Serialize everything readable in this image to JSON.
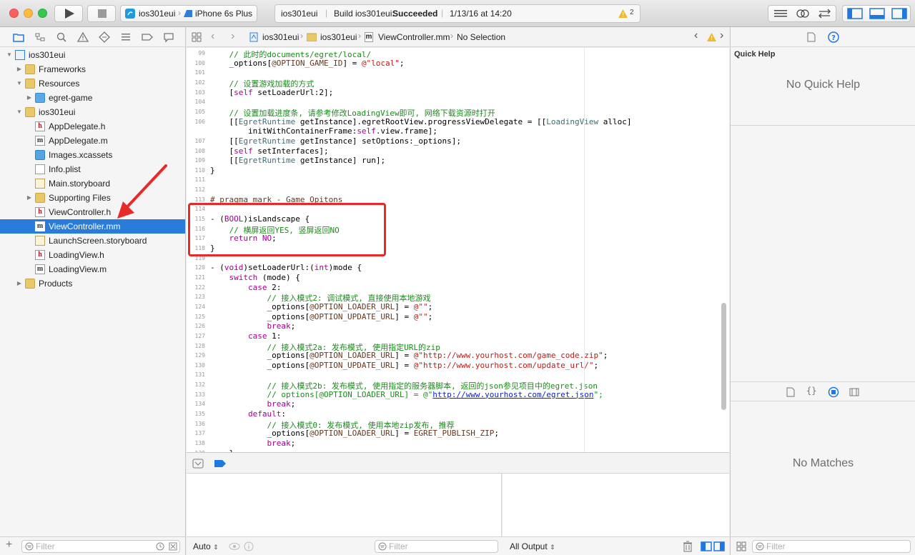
{
  "toolbar": {
    "scheme_target": "ios301eui",
    "scheme_device": "iPhone 6s Plus",
    "activity_project": "ios301eui",
    "activity_status_prefix": "Build ios301eui:",
    "activity_status_result": "Succeeded",
    "activity_date": "1/13/16 at 14:20",
    "warning_count": "2"
  },
  "navigator": {
    "tree": [
      {
        "label": "ios301eui",
        "icon": "project-icon",
        "level": 0,
        "open": true
      },
      {
        "label": "Frameworks",
        "icon": "folder-icon",
        "level": 1,
        "open": false
      },
      {
        "label": "Resources",
        "icon": "folder-icon",
        "level": 1,
        "open": true
      },
      {
        "label": "egret-game",
        "icon": "blue-folder-icon",
        "level": 2,
        "open": false
      },
      {
        "label": "ios301eui",
        "icon": "folder-icon",
        "level": 1,
        "open": true
      },
      {
        "label": "AppDelegate.h",
        "icon": "header-file-icon",
        "level": 2
      },
      {
        "label": "AppDelegate.m",
        "icon": "impl-file-icon",
        "level": 2
      },
      {
        "label": "Images.xcassets",
        "icon": "assets-icon",
        "level": 2
      },
      {
        "label": "Info.plist",
        "icon": "plist-file-icon",
        "level": 2
      },
      {
        "label": "Main.storyboard",
        "icon": "storyboard-icon",
        "level": 2
      },
      {
        "label": "Supporting Files",
        "icon": "folder-icon",
        "level": 2,
        "open": false
      },
      {
        "label": "ViewController.h",
        "icon": "header-file-icon",
        "level": 2
      },
      {
        "label": "ViewController.mm",
        "icon": "impl-file-icon",
        "level": 2,
        "selected": true
      },
      {
        "label": "LaunchScreen.storyboard",
        "icon": "storyboard-icon",
        "level": 2
      },
      {
        "label": "LoadingView.h",
        "icon": "header-file-icon",
        "level": 2
      },
      {
        "label": "LoadingView.m",
        "icon": "impl-file-icon",
        "level": 2
      },
      {
        "label": "Products",
        "icon": "folder-icon",
        "level": 1,
        "open": false
      }
    ],
    "filter_placeholder": "Filter"
  },
  "jumpbar": {
    "crumb_project": "ios301eui",
    "crumb_group": "ios301eui",
    "crumb_file": "ViewController.mm",
    "crumb_symbol": "No Selection"
  },
  "code": [
    {
      "n": "99",
      "html": "    <span class=\"cm\">// 此时的documents/egret/local/</span>"
    },
    {
      "n": "100",
      "html": "    _options[<span class=\"mac\">@OPTION_GAME_ID</span>] = <span class=\"st\">@\"local\"</span>;"
    },
    {
      "n": "101",
      "html": ""
    },
    {
      "n": "102",
      "html": "    <span class=\"cm\">// 设置游戏加载的方式</span>"
    },
    {
      "n": "103",
      "html": "    [<span class=\"kw\">self</span> setLoaderUrl:2];"
    },
    {
      "n": "104",
      "html": ""
    },
    {
      "n": "105",
      "html": "    <span class=\"cm\">// 设置加载进度条, 请参考修改LoadingView即可, 网络下载资源时打开</span>"
    },
    {
      "n": "106",
      "html": "    [[<span class=\"cls\">EgretRuntime</span> getInstance].egretRootView.progressViewDelegate = [[<span class=\"cls\">LoadingView</span> alloc]"
    },
    {
      "n": "",
      "html": "        initWithContainerFrame:<span class=\"kw\">self</span>.view.frame];"
    },
    {
      "n": "107",
      "html": "    [[<span class=\"cls\">EgretRuntime</span> getInstance] setOptions:_options];"
    },
    {
      "n": "108",
      "html": "    [<span class=\"kw\">self</span> setInterfaces];"
    },
    {
      "n": "109",
      "html": "    [[<span class=\"cls\">EgretRuntime</span> getInstance] run];"
    },
    {
      "n": "110",
      "html": "}"
    },
    {
      "n": "111",
      "html": ""
    },
    {
      "n": "112",
      "html": ""
    },
    {
      "n": "113",
      "html": "<span class=\"mac\"># pragma mark - Game Opitons</span>"
    },
    {
      "n": "114",
      "html": ""
    },
    {
      "n": "115",
      "html": "- (<span class=\"kw\">BOOL</span>)isLandscape {"
    },
    {
      "n": "116",
      "html": "    <span class=\"cm\">// 横屏返回YES, 竖屏返回NO</span>"
    },
    {
      "n": "117",
      "html": "    <span class=\"kw\">return</span> <span class=\"kw\">NO</span>;"
    },
    {
      "n": "118",
      "html": "}"
    },
    {
      "n": "119",
      "html": ""
    },
    {
      "n": "120",
      "html": "- (<span class=\"kw\">void</span>)setLoaderUrl:(<span class=\"kw\">int</span>)mode {"
    },
    {
      "n": "121",
      "html": "    <span class=\"kw\">switch</span> (mode) {"
    },
    {
      "n": "122",
      "html": "        <span class=\"kw\">case</span> 2:"
    },
    {
      "n": "123",
      "html": "            <span class=\"cm\">// 接入模式2: 调试模式, 直接使用本地游戏</span>"
    },
    {
      "n": "124",
      "html": "            _options[<span class=\"mac\">@OPTION_LOADER_URL</span>] = <span class=\"st\">@\"\"</span>;"
    },
    {
      "n": "125",
      "html": "            _options[<span class=\"mac\">@OPTION_UPDATE_URL</span>] = <span class=\"st\">@\"\"</span>;"
    },
    {
      "n": "126",
      "html": "            <span class=\"kw\">break</span>;"
    },
    {
      "n": "127",
      "html": "        <span class=\"kw\">case</span> 1:"
    },
    {
      "n": "128",
      "html": "            <span class=\"cm\">// 接入模式2a: 发布模式, 使用指定URL的zip</span>"
    },
    {
      "n": "129",
      "html": "            _options[<span class=\"mac\">@OPTION_LOADER_URL</span>] = <span class=\"st\">@\"http://www.yourhost.com/game_code.zip\"</span>;"
    },
    {
      "n": "130",
      "html": "            _options[<span class=\"mac\">@OPTION_UPDATE_URL</span>] = <span class=\"st\">@\"http://www.yourhost.com/update_url/\"</span>;"
    },
    {
      "n": "131",
      "html": ""
    },
    {
      "n": "132",
      "html": "            <span class=\"cm\">// 接入模式2b: 发布模式, 使用指定的服务器脚本, 返回的json参见项目中的egret.json</span>"
    },
    {
      "n": "133",
      "html": "            <span class=\"cm\">// options[@OPTION_LOADER_URL] = @\"<span class=\"url\">http://www.yourhost.com/egret.json</span>\";</span>"
    },
    {
      "n": "134",
      "html": "            <span class=\"kw\">break</span>;"
    },
    {
      "n": "135",
      "html": "        <span class=\"kw\">default</span>:"
    },
    {
      "n": "136",
      "html": "            <span class=\"cm\">// 接入模式0: 发布模式, 使用本地zip发布, 推荐</span>"
    },
    {
      "n": "137",
      "html": "            _options[<span class=\"mac\">@OPTION_LOADER_URL</span>] = <span class=\"mac\">EGRET_PUBLISH_ZIP</span>;"
    },
    {
      "n": "138",
      "html": "            <span class=\"kw\">break</span>;"
    },
    {
      "n": "139",
      "html": "    }"
    }
  ],
  "debug": {
    "auto_label": "Auto",
    "filter_placeholder": "Filter",
    "output_label": "All Output"
  },
  "inspector": {
    "quick_help_title": "Quick Help",
    "no_quick_help": "No Quick Help",
    "no_matches": "No Matches",
    "filter_placeholder": "Filter"
  }
}
